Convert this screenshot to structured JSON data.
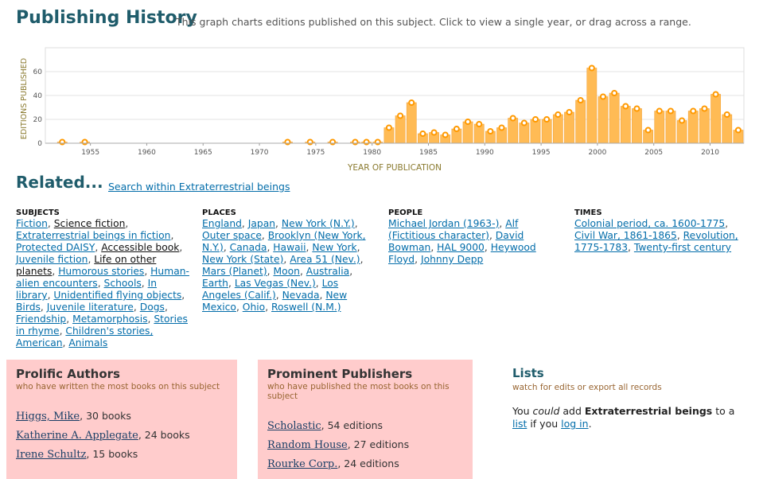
{
  "header": {
    "title": "Publishing History",
    "subtitle": "This graph charts editions published on this subject. Click to view a single year, or drag across a range."
  },
  "chart_data": {
    "type": "area",
    "xlabel": "YEAR OF PUBLICATION",
    "ylabel": "EDITIONS PUBLISHED",
    "xlim": [
      1951,
      2013
    ],
    "ylim": [
      0,
      80
    ],
    "xticks": [
      1955,
      1960,
      1965,
      1970,
      1975,
      1980,
      1985,
      1990,
      1995,
      2000,
      2005,
      2010
    ],
    "yticks": [
      0,
      20,
      40,
      60
    ],
    "grid": true,
    "bar_color": "#ffbb55",
    "point_color": "#ff9900",
    "x": [
      1951,
      1952,
      1953,
      1954,
      1955,
      1956,
      1957,
      1958,
      1959,
      1960,
      1961,
      1962,
      1963,
      1964,
      1965,
      1966,
      1967,
      1968,
      1969,
      1970,
      1971,
      1972,
      1973,
      1974,
      1975,
      1976,
      1977,
      1978,
      1979,
      1980,
      1981,
      1982,
      1983,
      1984,
      1985,
      1986,
      1987,
      1988,
      1989,
      1990,
      1991,
      1992,
      1993,
      1994,
      1995,
      1996,
      1997,
      1998,
      1999,
      2000,
      2001,
      2002,
      2003,
      2004,
      2005,
      2006,
      2007,
      2008,
      2009,
      2010,
      2011,
      2012
    ],
    "values": [
      0,
      1,
      0,
      1,
      0,
      0,
      0,
      0,
      0,
      0,
      0,
      0,
      0,
      0,
      0,
      0,
      0,
      0,
      0,
      0,
      0,
      1,
      0,
      1,
      0,
      1,
      0,
      1,
      1,
      1,
      13,
      23,
      34,
      8,
      9,
      7,
      12,
      18,
      16,
      10,
      13,
      21,
      17,
      20,
      20,
      24,
      26,
      36,
      63,
      39,
      42,
      31,
      29,
      11,
      27,
      27,
      19,
      27,
      29,
      41,
      24,
      11
    ]
  },
  "related": {
    "title": "Related...",
    "search_link": "Search within Extraterrestrial beings",
    "subjects": {
      "heading": "SUBJECTS",
      "items": [
        "Fiction",
        "Science fiction",
        "Extraterrestrial beings in fiction",
        "Protected DAISY",
        "Accessible book",
        "Juvenile fiction",
        "Life on other planets",
        "Humorous stories",
        "Human-alien encounters",
        "Schools",
        "In library",
        "Unidentified flying objects",
        "Birds",
        "Juvenile literature",
        "Dogs",
        "Friendship",
        "Metamorphosis",
        "Stories in rhyme",
        "Children's stories, American",
        "Animals"
      ]
    },
    "places": {
      "heading": "PLACES",
      "items": [
        "England",
        "Japan",
        "New York (N.Y.)",
        "Outer space",
        "Brooklyn (New York, N.Y.)",
        "Canada",
        "Hawaii",
        "New York",
        "New York (State)",
        "Area 51 (Nev.)",
        "Mars (Planet)",
        "Moon",
        "Australia",
        "Earth",
        "Las Vegas (Nev.)",
        "Los Angeles (Calif.)",
        "Nevada",
        "New Mexico",
        "Ohio",
        "Roswell (N.M.)"
      ]
    },
    "people": {
      "heading": "PEOPLE",
      "items": [
        "Michael Jordan (1963-)",
        "Alf (Fictitious character)",
        "David Bowman",
        "HAL 9000",
        "Heywood Floyd",
        "Johnny Depp"
      ]
    },
    "times": {
      "heading": "TIMES",
      "items": [
        "Colonial period, ca. 1600-1775",
        "Civil War, 1861-1865",
        "Revolution, 1775-1783",
        "Twenty-first century"
      ]
    }
  },
  "authors": {
    "title": "Prolific Authors",
    "desc": "who have written the most books on this subject",
    "items": [
      {
        "name": "Higgs, Mike",
        "count": "30 books"
      },
      {
        "name": "Katherine A. Applegate",
        "count": "24 books"
      },
      {
        "name": "Irene Schultz",
        "count": "15 books"
      }
    ]
  },
  "publishers": {
    "title": "Prominent Publishers",
    "desc": "who have published the most books on this subject",
    "items": [
      {
        "name": "Scholastic",
        "count": "54 editions"
      },
      {
        "name": "Random House",
        "count": "27 editions"
      },
      {
        "name": "Rourke Corp.",
        "count": "24 editions"
      }
    ]
  },
  "lists": {
    "title": "Lists",
    "desc": "watch for edits or export all records",
    "msg_pre": "You ",
    "msg_could": "could",
    "msg_mid1": " add ",
    "msg_subject": "Extraterrestrial beings",
    "msg_mid2": " to a ",
    "msg_list": "list",
    "msg_mid3": " if you ",
    "msg_login": "log in",
    "msg_end": "."
  }
}
